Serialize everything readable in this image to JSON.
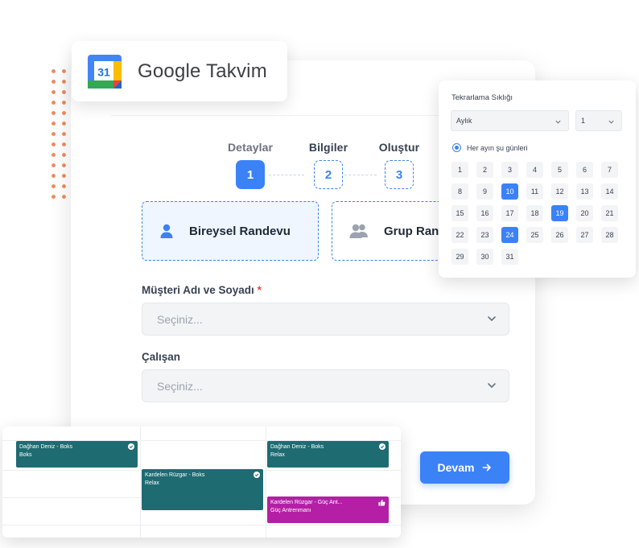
{
  "google_calendar": {
    "badge_day": "31",
    "name": "Google Takvim"
  },
  "steps": [
    {
      "label": "Detaylar",
      "number": "1",
      "state": "active"
    },
    {
      "label": "Bilgiler",
      "number": "2",
      "state": "pending"
    },
    {
      "label": "Oluştur",
      "number": "3",
      "state": "pending"
    }
  ],
  "appointment_types": [
    {
      "label": "Bireysel Randevu",
      "icon": "user-icon",
      "selected": true
    },
    {
      "label": "Grup Ran",
      "icon": "users-icon",
      "selected": false
    }
  ],
  "customer_field": {
    "label": "Müşteri Adı ve Soyadı",
    "required_mark": "*",
    "placeholder": "Seçiniz..."
  },
  "employee_field": {
    "label": "Çalışan",
    "placeholder": "Seçiniz..."
  },
  "continue_button": {
    "label": "Devam",
    "icon": "arrow-right-icon"
  },
  "recurrence": {
    "title": "Tekrarlama Sıklığı",
    "frequency": "Aylık",
    "interval": "1",
    "option_label": "Her ayın şu günleri",
    "days": [
      "1",
      "2",
      "3",
      "4",
      "5",
      "6",
      "7",
      "8",
      "9",
      "10",
      "11",
      "12",
      "13",
      "14",
      "15",
      "16",
      "17",
      "18",
      "19",
      "20",
      "21",
      "22",
      "23",
      "24",
      "25",
      "26",
      "27",
      "28",
      "29",
      "30",
      "31"
    ],
    "selected_days": [
      "10",
      "19",
      "24"
    ]
  },
  "calendar_events": [
    {
      "title": "Dağhan Deniz - Boks",
      "subtitle": "Boks",
      "color": "#1e6b72",
      "icon": "check-circle-icon"
    },
    {
      "title": "Kardelen Rüzgar - Boks",
      "subtitle": "Relax",
      "color": "#1e6b72",
      "icon": "check-circle-icon"
    },
    {
      "title": "Dağhan Deniz - Boks",
      "subtitle": "Relax",
      "color": "#1e6b72",
      "icon": "check-circle-icon"
    },
    {
      "title": "Kardelen Rüzgar - Güç Ant...",
      "subtitle": "Güç Antrenmanı",
      "color": "#b51fa5",
      "icon": "thumbs-up-icon"
    }
  ]
}
